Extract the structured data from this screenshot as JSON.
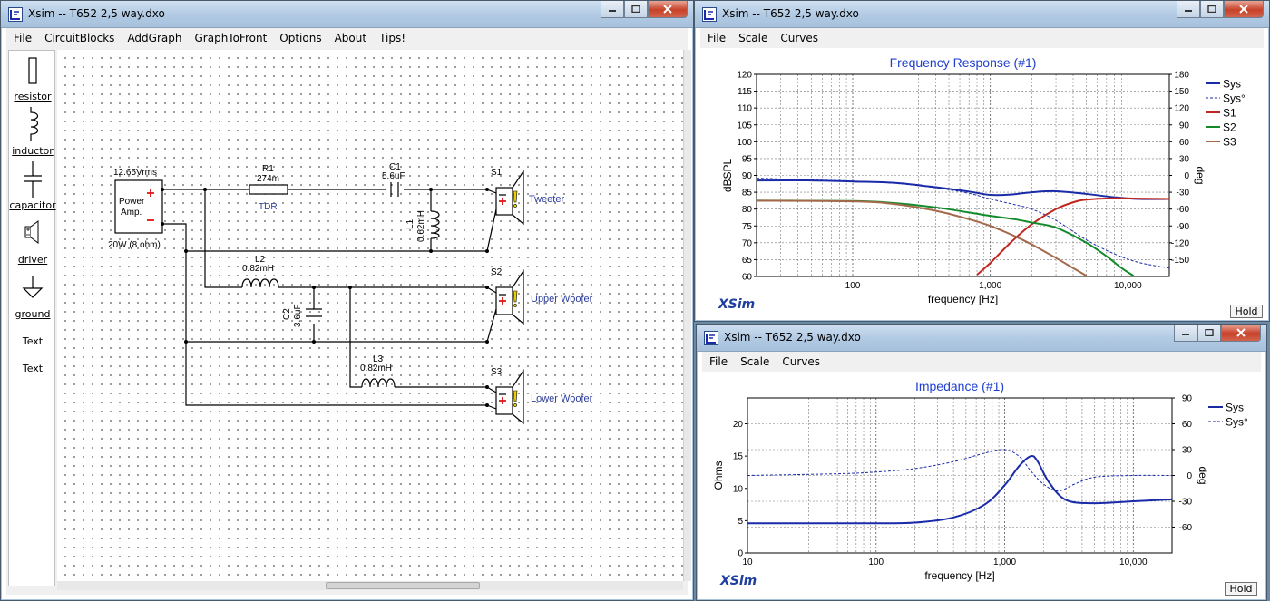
{
  "schematic_window": {
    "title": "Xsim -- T652 2,5 way.dxo",
    "menu": [
      "File",
      "CircuitBlocks",
      "AddGraph",
      "GraphToFront",
      "Options",
      "About",
      "Tips!"
    ],
    "palette": [
      "resistor",
      "inductor",
      "capacitor",
      "driver",
      "ground",
      "Text",
      "Text"
    ],
    "components": {
      "amp_voltage": "12.65Vrms",
      "amp_label_1": "Power",
      "amp_label_2": "Amp.",
      "amp_power": "20W (8 ohm)",
      "r1_name": "R1",
      "r1_value": "274m",
      "r1_note": "TDR",
      "c1_name": "C1",
      "c1_value": "5.6uF",
      "l1_name": "L1",
      "l1_value": "0.62mH",
      "l2_name": "L2",
      "l2_value": "0.82mH",
      "c2_name": "C2",
      "c2_value": "3.6uF",
      "l3_name": "L3",
      "l3_value": "0.82mH",
      "s1_name": "S1",
      "s1_label": "Tweeter",
      "s2_name": "S2",
      "s2_label": "Upper Woofer",
      "s3_name": "S3",
      "s3_label": "Lower Woofer"
    }
  },
  "freq_window": {
    "title": "Xsim -- T652 2,5 way.dxo",
    "menu": [
      "File",
      "Scale",
      "Curves"
    ],
    "hold": "Hold",
    "brand": "XSim"
  },
  "imp_window": {
    "title": "Xsim -- T652 2,5 way.dxo",
    "menu": [
      "File",
      "Scale",
      "Curves"
    ],
    "hold": "Hold",
    "brand": "XSim"
  },
  "chart_data": [
    {
      "type": "line",
      "title": "Frequency Response (#1)",
      "xlabel": "frequency [Hz]",
      "ylabel": "dBSPL",
      "y2label": "deg",
      "xscale": "log",
      "xlim": [
        20,
        20000
      ],
      "ylim": [
        60,
        120
      ],
      "y2lim": [
        -180,
        180
      ],
      "xticks": [
        100,
        1000,
        10000
      ],
      "xticklabels": [
        "100",
        "1,000",
        "10,000"
      ],
      "yticks": [
        60,
        65,
        70,
        75,
        80,
        85,
        90,
        95,
        100,
        105,
        110,
        115,
        120
      ],
      "y2ticks": [
        -150,
        -120,
        -90,
        -60,
        -30,
        0,
        30,
        60,
        90,
        120,
        150,
        180
      ],
      "legend_position": "right",
      "grid": true,
      "series": [
        {
          "name": "Sys",
          "color": "#1a2ba8",
          "width": 2,
          "dash": "",
          "x": [
            20,
            50,
            100,
            200,
            400,
            700,
            1000,
            1400,
            2000,
            3000,
            5000,
            8000,
            12000,
            20000
          ],
          "y": [
            88.5,
            88.5,
            88.2,
            87.8,
            86.5,
            85.2,
            84.2,
            84.3,
            85.0,
            85.3,
            84.5,
            83.5,
            83.0,
            83.0
          ]
        },
        {
          "name": "Sys°",
          "color": "#1a2ba8",
          "width": 1,
          "dash": "3,2",
          "x": [
            20,
            50,
            100,
            200,
            400,
            700,
            1000,
            1500,
            2000,
            3000,
            5000,
            8000,
            12000,
            20000
          ],
          "y2": [
            -5,
            -8,
            -10,
            -14,
            -22,
            -32,
            -42,
            -52,
            -60,
            -80,
            -115,
            -140,
            -155,
            -165
          ]
        },
        {
          "name": "S1",
          "color": "#c0261f",
          "width": 2,
          "dash": "",
          "x": [
            800,
            1000,
            1400,
            2000,
            3000,
            4000,
            5000,
            8000,
            12000,
            20000
          ],
          "y": [
            60.5,
            64,
            70,
            75.5,
            80,
            82,
            82.8,
            83.2,
            83.1,
            83.0
          ]
        },
        {
          "name": "S2",
          "color": "#138a2a",
          "width": 2,
          "dash": "",
          "x": [
            20,
            100,
            200,
            400,
            700,
            1000,
            1500,
            2000,
            3000,
            5000,
            7000,
            9000,
            11000
          ],
          "y": [
            82.5,
            82.4,
            81.8,
            80.5,
            79.0,
            78.0,
            77.0,
            76.0,
            74.5,
            70.0,
            66.0,
            62.5,
            60.2
          ]
        },
        {
          "name": "S3",
          "color": "#a4694a",
          "width": 2,
          "dash": "",
          "x": [
            20,
            100,
            200,
            400,
            700,
            1000,
            1500,
            2000,
            3000,
            4000,
            5000
          ],
          "y": [
            82.5,
            82.3,
            81.5,
            79.5,
            77.0,
            75.0,
            72.0,
            69.5,
            65.5,
            62.5,
            60.2
          ]
        }
      ]
    },
    {
      "type": "line",
      "title": "Impedance (#1)",
      "xlabel": "frequency [Hz]",
      "ylabel": "Ohms",
      "y2label": "deg",
      "xscale": "log",
      "xlim": [
        10,
        20000
      ],
      "ylim": [
        0,
        24
      ],
      "y2lim": [
        -90,
        90
      ],
      "xticks": [
        10,
        100,
        1000,
        10000
      ],
      "xticklabels": [
        "10",
        "100",
        "1,000",
        "10,000"
      ],
      "yticks": [
        0,
        5,
        10,
        15,
        20
      ],
      "y2ticks": [
        -60,
        -30,
        0,
        30,
        60,
        90
      ],
      "legend_position": "right",
      "grid": true,
      "series": [
        {
          "name": "Sys",
          "color": "#1a2ba8",
          "width": 2,
          "dash": "",
          "x": [
            10,
            50,
            100,
            200,
            400,
            700,
            1000,
            1300,
            1600,
            1800,
            2200,
            3000,
            5000,
            10000,
            20000
          ],
          "y": [
            4.6,
            4.6,
            4.6,
            4.7,
            5.5,
            7.5,
            10.5,
            13.5,
            15.0,
            14.2,
            11.0,
            8.2,
            7.7,
            8.0,
            8.3
          ]
        },
        {
          "name": "Sys°",
          "color": "#1a2ba8",
          "width": 1,
          "dash": "3,2",
          "x": [
            10,
            50,
            100,
            200,
            400,
            700,
            1000,
            1300,
            1600,
            2000,
            2600,
            3500,
            5000,
            10000,
            20000
          ],
          "y2": [
            0,
            2,
            4,
            8,
            16,
            26,
            30,
            22,
            5,
            -10,
            -18,
            -10,
            -2,
            0,
            0
          ]
        }
      ]
    }
  ]
}
